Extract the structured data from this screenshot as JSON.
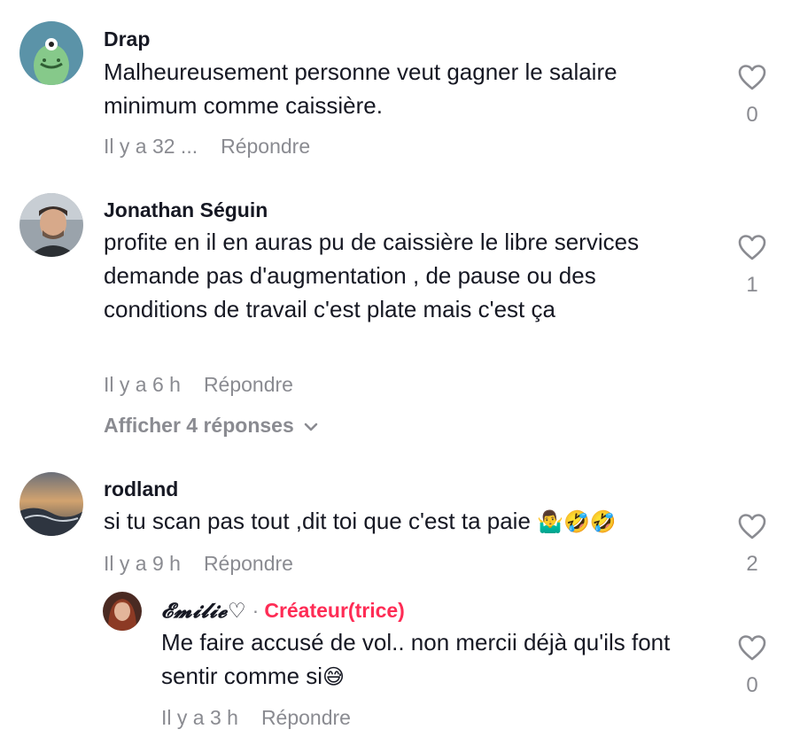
{
  "comments": [
    {
      "username": "Drap",
      "text": "Malheureusement personne veut gagner le salaire minimum comme caissière.",
      "time": "Il y a 32 ...",
      "reply_label": "Répondre",
      "likes": "0",
      "avatar": "green-monster-avatar"
    },
    {
      "username": "Jonathan Séguin",
      "text": "profite en il en auras pu de caissière le libre services demande pas d'augmentation , de pause ou des conditions de travail c'est plate mais c'est ça",
      "time": "Il y a 6 h",
      "reply_label": "Répondre",
      "likes": "1",
      "view_replies": "Afficher 4 réponses",
      "avatar": "man-photo-avatar"
    },
    {
      "username": "rodland",
      "text": "si tu scan pas tout ,dit toi que c'est ta paie",
      "emojis": "🤷‍♂️🤣🤣",
      "time": "Il y a 9 h",
      "reply_label": "Répondre",
      "likes": "2",
      "avatar": "sunset-water-avatar"
    }
  ],
  "reply": {
    "username": "𝓔𝓶𝓲𝓵𝓲𝓮♡",
    "separator": "·",
    "badge": "Créateur(trice)",
    "text": "Me faire accusé de vol.. non mercii déjà qu'ils font sentir comme si",
    "emoji": "😅",
    "time": "Il y a 3 h",
    "reply_label": "Répondre",
    "likes": "0",
    "avatar": "woman-photo-avatar"
  },
  "colors": {
    "text": "#161823",
    "muted": "#8a8b91",
    "creator_badge": "#fe2c55"
  },
  "icons": {
    "like": "heart-outline-icon",
    "expand": "chevron-down-icon"
  }
}
